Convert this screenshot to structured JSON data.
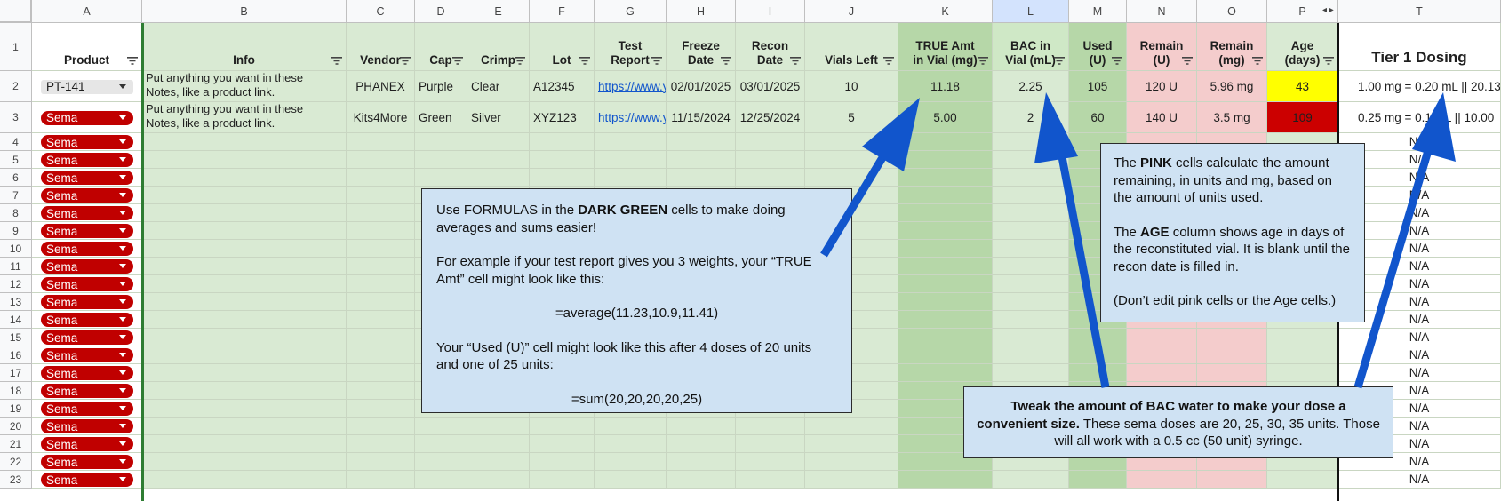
{
  "columns": [
    "A",
    "B",
    "C",
    "D",
    "E",
    "F",
    "G",
    "H",
    "I",
    "J",
    "K",
    "L",
    "M",
    "N",
    "O",
    "P",
    "T"
  ],
  "headers": {
    "product": "Product",
    "info": "Info",
    "vendor": "Vendor",
    "cap": "Cap",
    "crimp": "Crimp",
    "lot": "Lot",
    "test_report": "Test\nReport",
    "freeze_date": "Freeze\nDate",
    "recon_date": "Recon\nDate",
    "vials_left": "Vials Left",
    "true_amt": "TRUE Amt\nin Vial (mg)",
    "bac": "BAC in\nVial (mL)",
    "used": "Used\n(U)",
    "remain_u": "Remain\n(U)",
    "remain_mg": "Remain\n(mg)",
    "age": "Age\n(days)",
    "tier1": "Tier 1 Dosing"
  },
  "row_numbers": [
    "1",
    "2",
    "3",
    "4",
    "5",
    "6",
    "7",
    "8",
    "9",
    "10",
    "11",
    "12",
    "13",
    "14",
    "15",
    "16",
    "17",
    "18",
    "19",
    "20",
    "21",
    "22",
    "23"
  ],
  "rows": [
    {
      "product": "PT-141",
      "info_line1": "Put anything you want in these",
      "info_line2": "Notes, like a product link.",
      "vendor": "PHANEX",
      "cap": "Purple",
      "crimp": "Clear",
      "lot": "A12345",
      "test_report": "https://www.y",
      "freeze_date": "02/01/2025",
      "recon_date": "03/01/2025",
      "vials_left": "10",
      "true_amt": "11.18",
      "bac": "2.25",
      "used": "105",
      "remain_u": "120 U",
      "remain_mg": "5.96 mg",
      "age": "43",
      "tier1": "1.00 mg = 0.20 mL || 20.13"
    },
    {
      "product": "Sema",
      "info_line1": "Put anything you want in these",
      "info_line2": "Notes, like a product link.",
      "vendor": "Kits4More",
      "cap": "Green",
      "crimp": "Silver",
      "lot": "XYZ123",
      "test_report": "https://www.y",
      "freeze_date": "11/15/2024",
      "recon_date": "12/25/2024",
      "vials_left": "5",
      "true_amt": "5.00",
      "bac": "2",
      "used": "60",
      "remain_u": "140 U",
      "remain_mg": "3.5 mg",
      "age": "109",
      "tier1": "0.25 mg = 0.1 mL || 10.00"
    }
  ],
  "empty_row_product": "Sema",
  "empty_row_tier1": "N/A",
  "notes": {
    "formulas": {
      "intro_pre": "Use FORMULAS in the ",
      "intro_bold": "DARK GREEN",
      "intro_post": " cells to make doing averages and sums easier!",
      "example": "For example if your test report gives you 3 weights, your “TRUE Amt” cell might look like this:",
      "formula1": "=average(11.23,10.9,11.41)",
      "used_text": "Your “Used (U)” cell might look like this after 4 doses of 20 units and one of 25 units:",
      "formula2": "=sum(20,20,20,20,25)"
    },
    "pink": {
      "p1_pre": "The ",
      "p1_bold": "PINK",
      "p1_post": " cells calculate the amount remaining, in units and mg, based on the amount of units used.",
      "p2_pre": "The ",
      "p2_bold": "AGE",
      "p2_post": " column shows age in days of the reconstituted vial. It is blank until the recon date is filled in.",
      "p3": "(Don’t edit pink cells or the Age cells.)"
    },
    "bac": {
      "bold": "Tweak the amount of BAC water to make your dose a convenient size.",
      "rest": " These sema doses are 20, 25, 30, 35 units. Those will all work with a 0.5 cc (50 unit) syringe."
    }
  },
  "colors": {
    "light_green": "#d9ead3",
    "dark_green": "#b6d7a8",
    "pink": "#f4cccc",
    "yellow": "#ffff00",
    "red": "#cc0000",
    "chip_red": "#c00000",
    "note_blue": "#cfe2f3",
    "arrow_blue": "#1155cc"
  }
}
